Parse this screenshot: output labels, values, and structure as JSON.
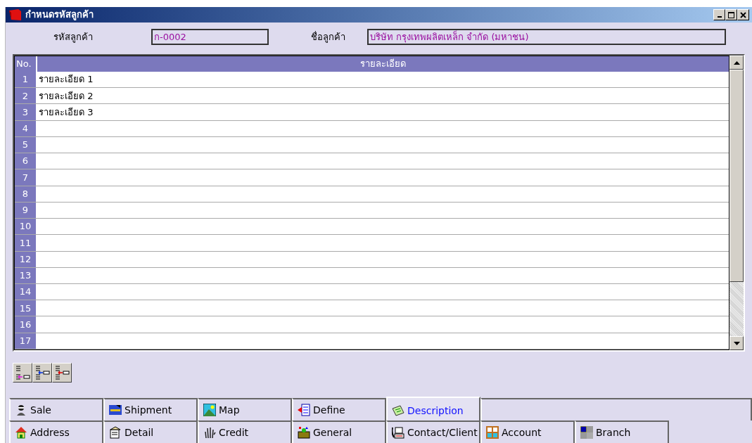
{
  "window": {
    "title": "กำหนดรหัสลูกค้า"
  },
  "fields": [
    {
      "label": "รหัสลูกค้า",
      "value": "ก-0002"
    },
    {
      "label": "ชื่อลูกค้า",
      "value": "บริษัท กรุงเทพผลิตเหล็ก จำกัด (มหาชน)"
    }
  ],
  "table": {
    "columns": [
      "No.",
      "รายละเอียด"
    ],
    "rows": [
      {
        "no": "1",
        "text": "รายละเอียด 1"
      },
      {
        "no": "2",
        "text": "รายละเอียด 2"
      },
      {
        "no": "3",
        "text": "รายละเอียด 3"
      },
      {
        "no": "4"
      },
      {
        "no": "5"
      },
      {
        "no": "6"
      },
      {
        "no": "7"
      },
      {
        "no": "8"
      },
      {
        "no": "9"
      },
      {
        "no": "10"
      },
      {
        "no": "11"
      },
      {
        "no": "12"
      },
      {
        "no": "13"
      },
      {
        "no": "14"
      },
      {
        "no": "15"
      },
      {
        "no": "16"
      },
      {
        "no": "17"
      }
    ]
  },
  "tool_buttons": [
    {
      "kind": "append"
    },
    {
      "kind": "insert"
    },
    {
      "kind": "delete"
    }
  ],
  "tab_rows": [
    [
      {
        "label": "Sale",
        "selected": false
      },
      {
        "label": "Shipment",
        "selected": false
      },
      {
        "label": "Map",
        "selected": false
      },
      {
        "label": "Define",
        "selected": false
      },
      {
        "label": "Description",
        "selected": true
      }
    ],
    [
      {
        "label": "Address",
        "selected": false
      },
      {
        "label": "Detail",
        "selected": false
      },
      {
        "label": "Credit",
        "selected": false
      },
      {
        "label": "General",
        "selected": false
      },
      {
        "label": "Contact/Client",
        "selected": false
      },
      {
        "label": "Account",
        "selected": false
      },
      {
        "label": "Branch",
        "selected": false
      }
    ]
  ]
}
